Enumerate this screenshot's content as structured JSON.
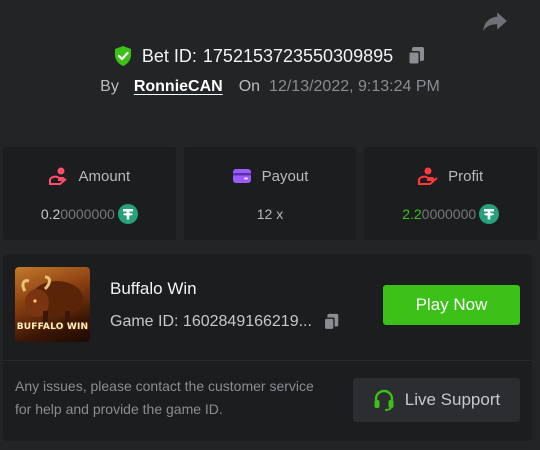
{
  "header": {
    "bet_label": "Bet ID:",
    "bet_id": "1752153723550309895",
    "by_label": "By",
    "username": "RonnieCAN",
    "on_label": "On",
    "date": "12/13/2022, 9:13:24 PM"
  },
  "stats": {
    "amount": {
      "label": "Amount",
      "value_main": "0.2",
      "value_dim": "0000000"
    },
    "payout": {
      "label": "Payout",
      "value": "12 x"
    },
    "profit": {
      "label": "Profit",
      "value_main": "2.2",
      "value_dim": "0000000"
    }
  },
  "game": {
    "name": "Buffalo Win",
    "thumb_text": "BUFFALO WIN",
    "id_label": "Game ID:",
    "id_value": "1602849166219...",
    "play_label": "Play Now"
  },
  "support": {
    "notice": "Any issues, please contact the customer service for help and provide the game ID.",
    "button_label": "Live Support"
  },
  "colors": {
    "background": "#232426",
    "panel": "#1c1d1f",
    "accent_green": "#3bc117",
    "tether": "#26a17b",
    "amount_icon": "#ff4d6d",
    "payout_icon": "#9b5cff",
    "profit_icon": "#ff3a3a"
  },
  "icons": [
    "share-icon",
    "shield-check-icon",
    "copy-icon",
    "coins-icon",
    "wallet-icon",
    "hand-coin-icon",
    "tether-icon",
    "headset-icon"
  ]
}
